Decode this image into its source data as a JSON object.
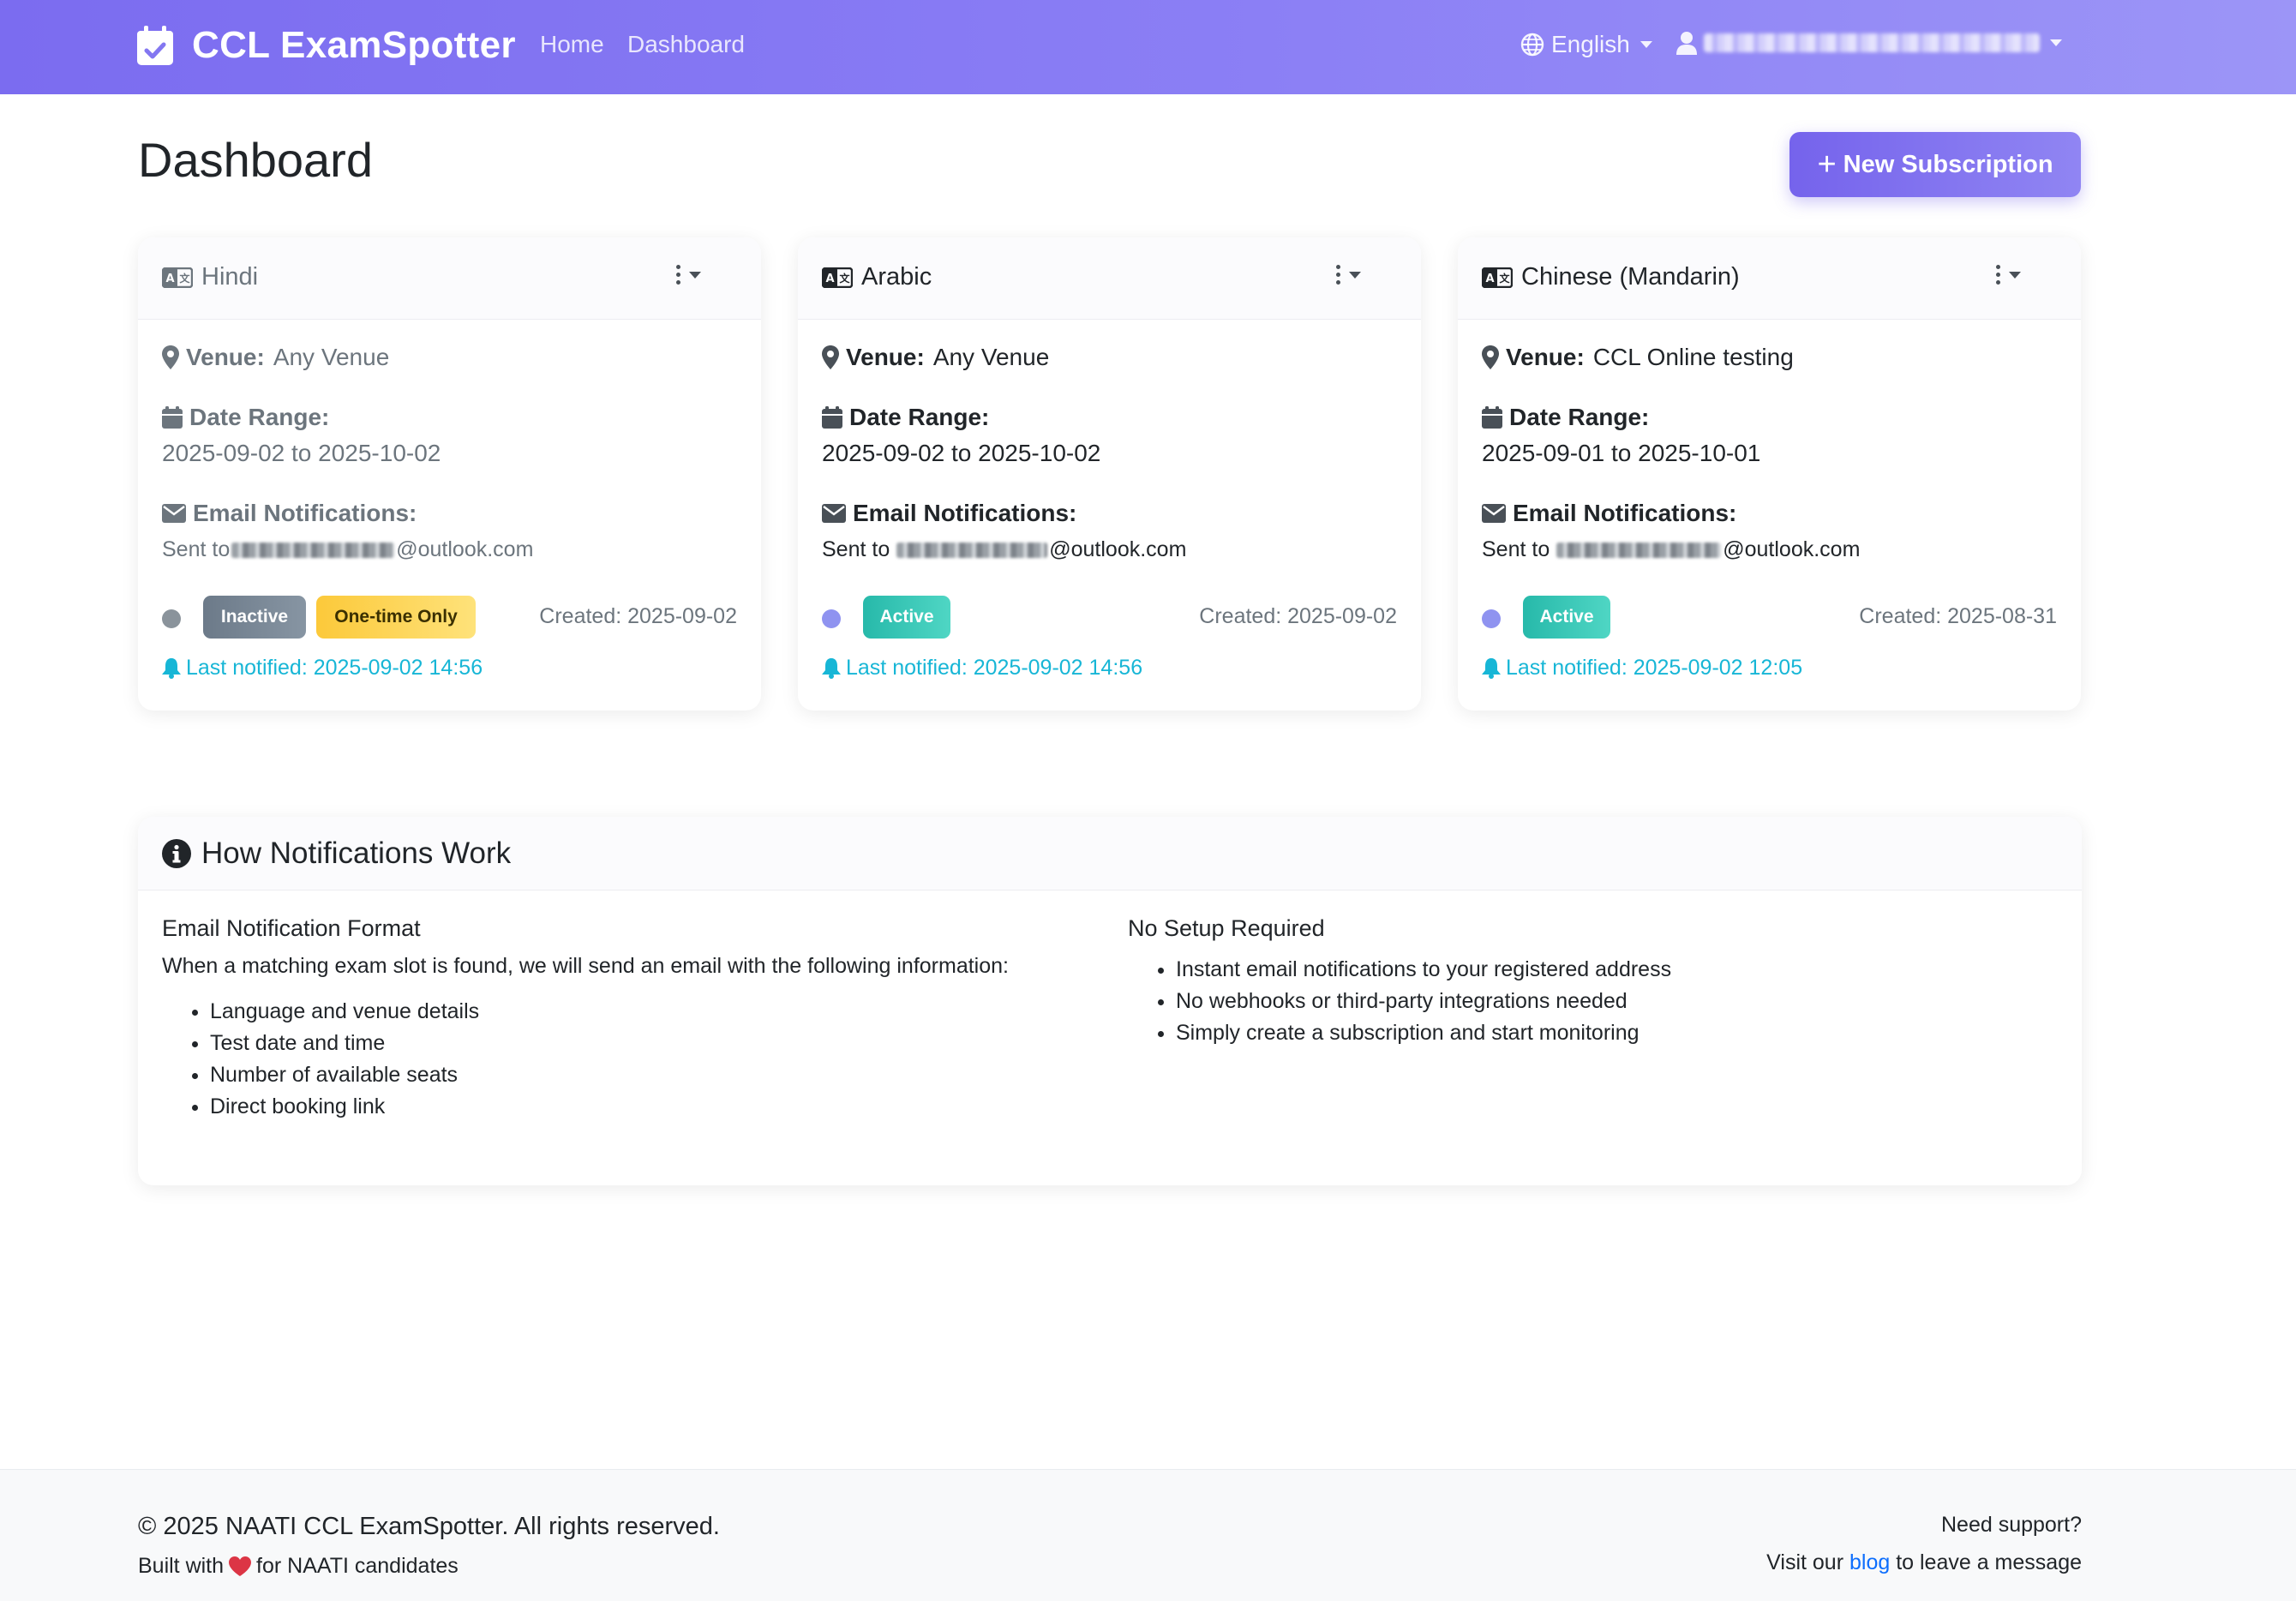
{
  "nav": {
    "brand": "CCL ExamSpotter",
    "links": [
      "Home",
      "Dashboard"
    ],
    "language": "English",
    "user_icon": "user-icon",
    "globe_icon": "globe-icon"
  },
  "page": {
    "title": "Dashboard",
    "new_subscription": "New Subscription"
  },
  "labels": {
    "venue": "Venue:",
    "date_range": "Date Range:",
    "email_notifications": "Email Notifications:",
    "sent_to": "Sent to"
  },
  "cards": [
    {
      "language": "Hindi",
      "venue": "Any Venue",
      "date_range": "2025-09-02 to 2025-10-02",
      "email_suffix": "@outlook.com",
      "status": "Inactive",
      "extra_badge": "One-time Only",
      "created": "Created: 2025-09-02",
      "last_notified": "Last notified: 2025-09-02 14:56"
    },
    {
      "language": "Arabic",
      "venue": "Any Venue",
      "date_range": "2025-09-02 to 2025-10-02",
      "email_suffix": "@outlook.com",
      "status": "Active",
      "created": "Created: 2025-09-02",
      "last_notified": "Last notified: 2025-09-02 14:56"
    },
    {
      "language": "Chinese (Mandarin)",
      "venue": "CCL Online testing",
      "date_range": "2025-09-01 to 2025-10-01",
      "email_suffix": "@outlook.com",
      "status": "Active",
      "created": "Created: 2025-08-31",
      "last_notified": "Last notified: 2025-09-02 12:05"
    }
  ],
  "info": {
    "title": "How Notifications Work",
    "col1": {
      "heading": "Email Notification Format",
      "intro": "When a matching exam slot is found, we will send an email with the following information:",
      "items": [
        "Language and venue details",
        "Test date and time",
        "Number of available seats",
        "Direct booking link"
      ]
    },
    "col2": {
      "heading": "No Setup Required",
      "items": [
        "Instant email notifications to your registered address",
        "No webhooks or third-party integrations needed",
        "Simply create a subscription and start monitoring"
      ]
    }
  },
  "footer": {
    "copyright": "© 2025 NAATI CCL ExamSpotter. All rights reserved.",
    "built_prefix": "Built with",
    "built_suffix": "for NAATI candidates",
    "support": "Need support?",
    "visit_prefix": "Visit our",
    "blog": "blog",
    "visit_suffix": "to leave a message"
  },
  "colors": {
    "accent": "#7b6cf0",
    "active": "#2ec4b6",
    "inactive": "#6c7a89",
    "one_time": "#fdd24a",
    "notified": "#17b6d6"
  }
}
